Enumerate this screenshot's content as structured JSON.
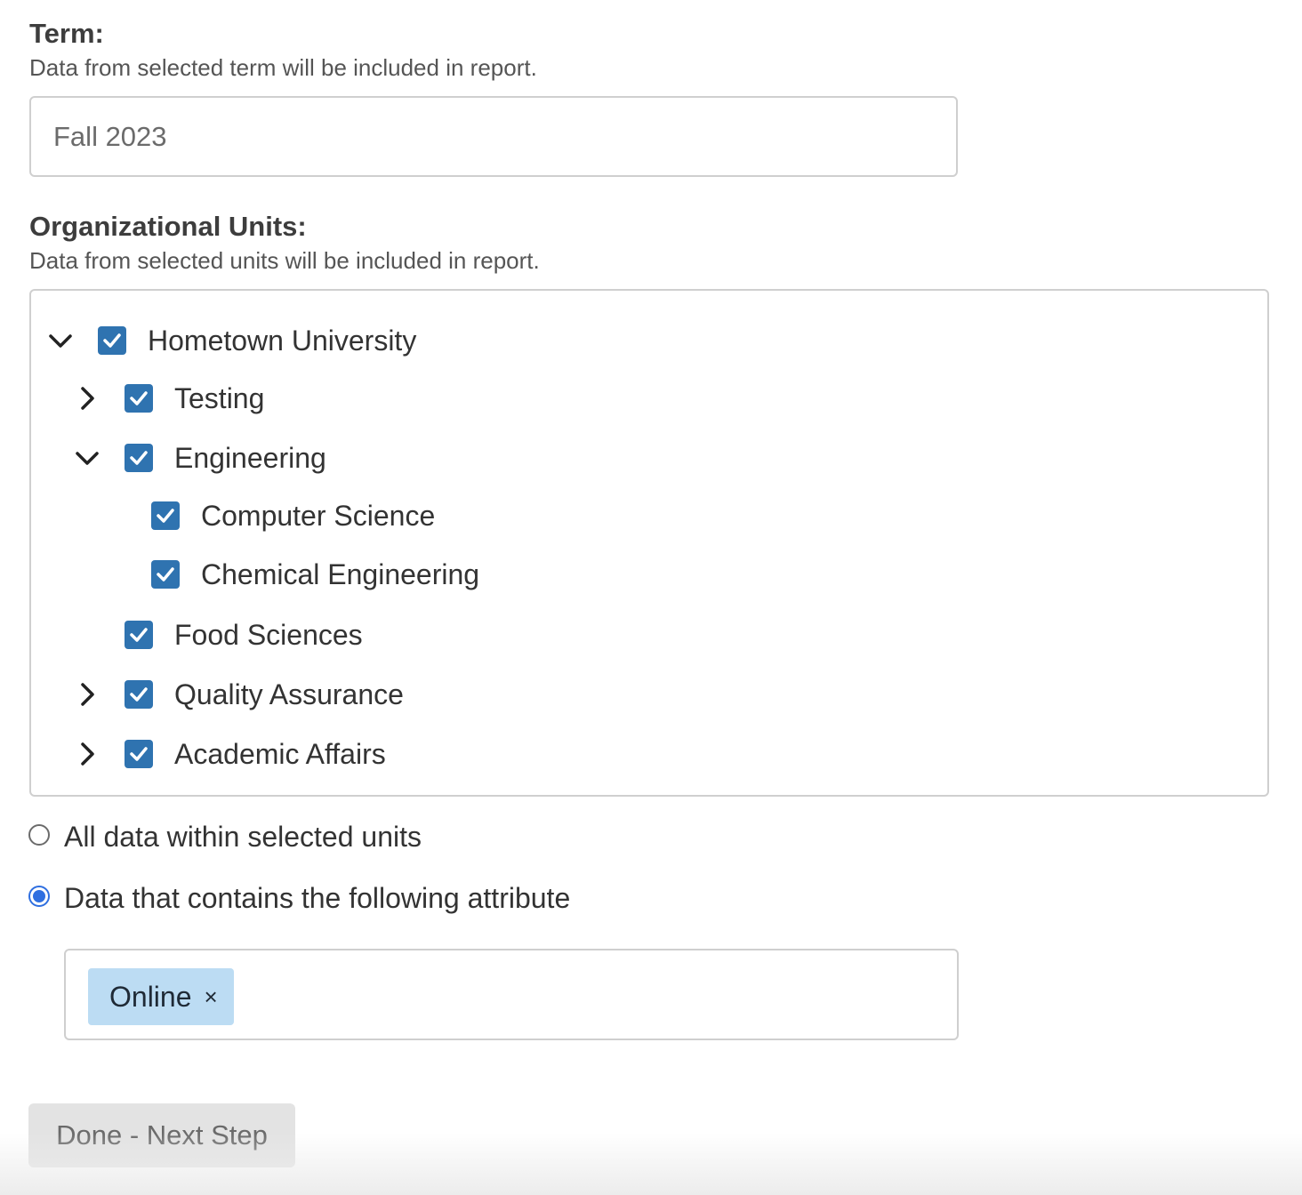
{
  "term": {
    "title": "Term:",
    "description": "Data from selected term will be included in report.",
    "value": "Fall 2023"
  },
  "units": {
    "title": "Organizational Units:",
    "description": "Data from selected units will be included in report.",
    "tree": [
      {
        "label": "Hometown University",
        "toggle": "expanded",
        "checked": true,
        "level": 0
      },
      {
        "label": "Testing",
        "toggle": "collapsed",
        "checked": true,
        "level": 1
      },
      {
        "label": "Engineering",
        "toggle": "expanded",
        "checked": true,
        "level": 1
      },
      {
        "label": "Computer Science",
        "toggle": "none",
        "checked": true,
        "level": 2
      },
      {
        "label": "Chemical Engineering",
        "toggle": "none",
        "checked": true,
        "level": 2
      },
      {
        "label": "Food Sciences",
        "toggle": "none",
        "checked": true,
        "level": 1
      },
      {
        "label": "Quality Assurance",
        "toggle": "collapsed",
        "checked": true,
        "level": 1
      },
      {
        "label": "Academic Affairs",
        "toggle": "collapsed",
        "checked": true,
        "level": 1
      }
    ]
  },
  "scope": {
    "options": [
      {
        "label": "All data within selected units",
        "selected": false
      },
      {
        "label": "Data that contains the following attribute",
        "selected": true
      }
    ]
  },
  "attributes": {
    "tags": [
      {
        "label": "Online",
        "remove_symbol": "×"
      }
    ]
  },
  "actions": {
    "done_label": "Done - Next Step"
  },
  "colors": {
    "checkbox": "#2f73b0",
    "radio_selected": "#2f6fe0",
    "chip_bg": "#bcdcf3"
  }
}
